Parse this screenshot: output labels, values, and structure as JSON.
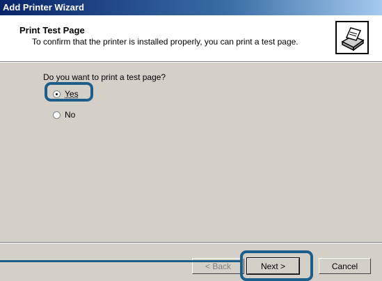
{
  "window": {
    "title": "Add Printer Wizard"
  },
  "header": {
    "title": "Print Test Page",
    "subtitle": "To confirm that the printer is installed properly, you can print a test page.",
    "icon": "printer-icon"
  },
  "body": {
    "question": "Do you want to print a test page?",
    "options": [
      {
        "label": "Yes",
        "selected": true
      },
      {
        "label": "No",
        "selected": false
      }
    ]
  },
  "footer": {
    "back_label": "< Back",
    "next_label": "Next >",
    "cancel_label": "Cancel"
  },
  "annotation_color": "#1c5f8c"
}
